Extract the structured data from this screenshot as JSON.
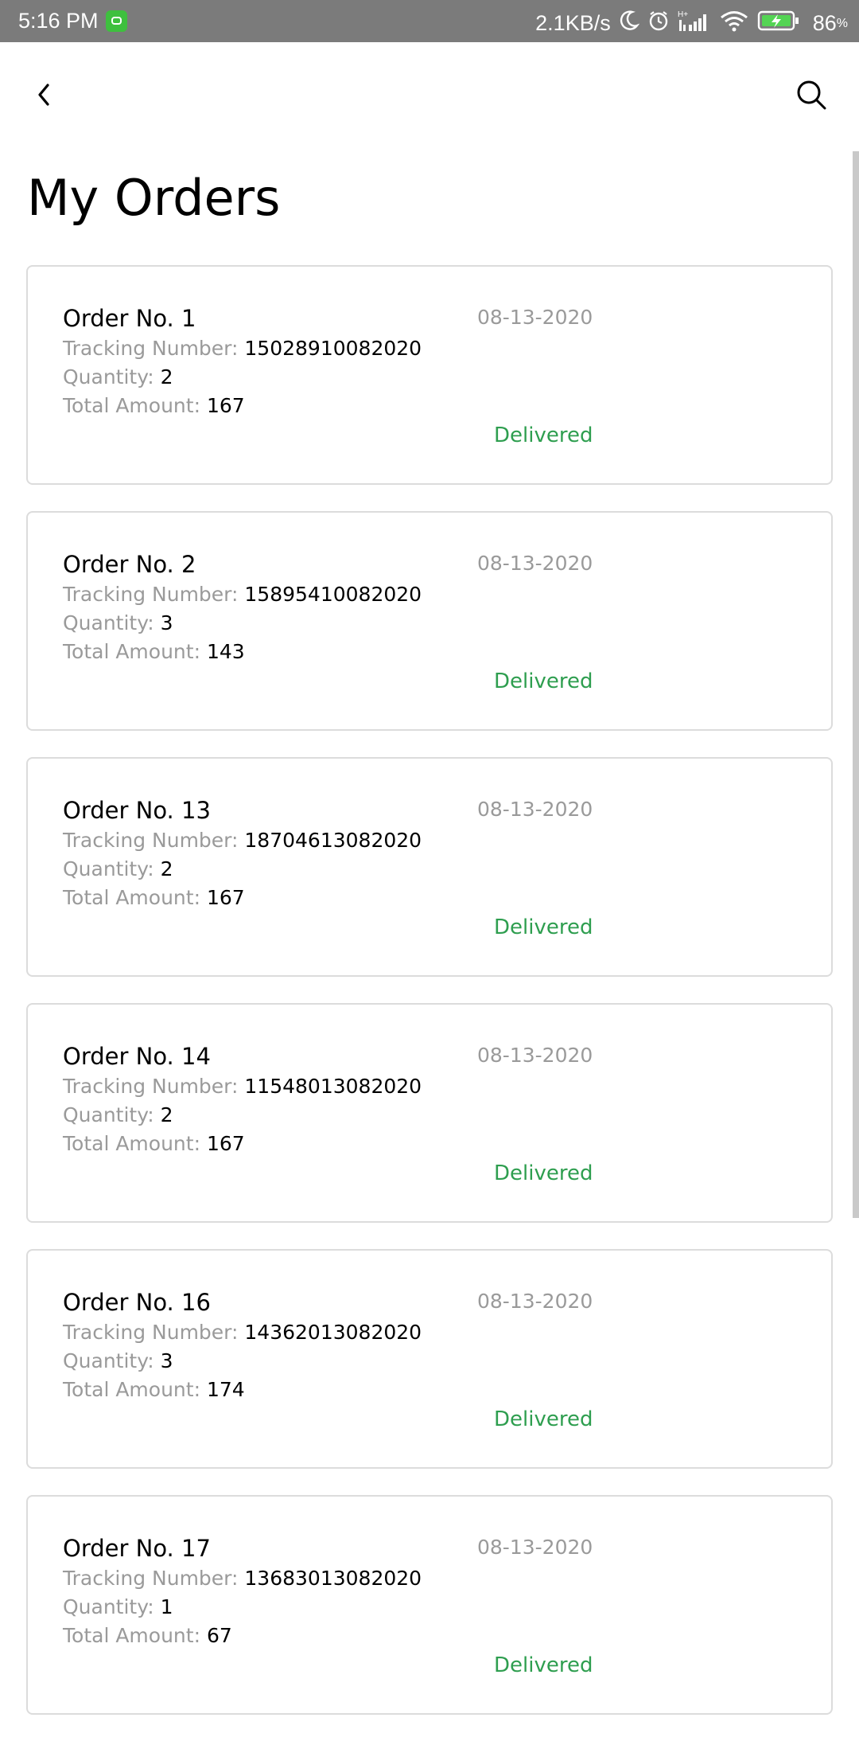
{
  "status_bar": {
    "time": "5:16 PM",
    "net_speed": "2.1KB/s",
    "network_type": "H+",
    "battery_percent": "86",
    "percent_sign": "%",
    "icons": [
      "app-notification-icon",
      "moon-icon",
      "alarm-icon",
      "signal-icon",
      "wifi-icon",
      "battery-charging-icon"
    ]
  },
  "header": {
    "back_icon": "chevron-left-icon",
    "search_icon": "search-icon"
  },
  "page": {
    "title": "My Orders"
  },
  "labels": {
    "tracking": "Tracking Number:",
    "quantity": "Quantity:",
    "total": "Total Amount:"
  },
  "colors": {
    "status_delivered": "#2e9e4f",
    "status_bar_bg": "#7b7b7b"
  },
  "orders": [
    {
      "title": "Order No. 1",
      "date": "08-13-2020",
      "tracking": "15028910082020",
      "quantity": "2",
      "total": "167",
      "status": "Delivered"
    },
    {
      "title": "Order No. 2",
      "date": "08-13-2020",
      "tracking": "15895410082020",
      "quantity": "3",
      "total": "143",
      "status": "Delivered"
    },
    {
      "title": "Order No. 13",
      "date": "08-13-2020",
      "tracking": "18704613082020",
      "quantity": "2",
      "total": "167",
      "status": "Delivered"
    },
    {
      "title": "Order No. 14",
      "date": "08-13-2020",
      "tracking": "11548013082020",
      "quantity": "2",
      "total": "167",
      "status": "Delivered"
    },
    {
      "title": "Order No. 16",
      "date": "08-13-2020",
      "tracking": "14362013082020",
      "quantity": "3",
      "total": "174",
      "status": "Delivered"
    },
    {
      "title": "Order No. 17",
      "date": "08-13-2020",
      "tracking": "13683013082020",
      "quantity": "1",
      "total": "67",
      "status": "Delivered"
    }
  ]
}
